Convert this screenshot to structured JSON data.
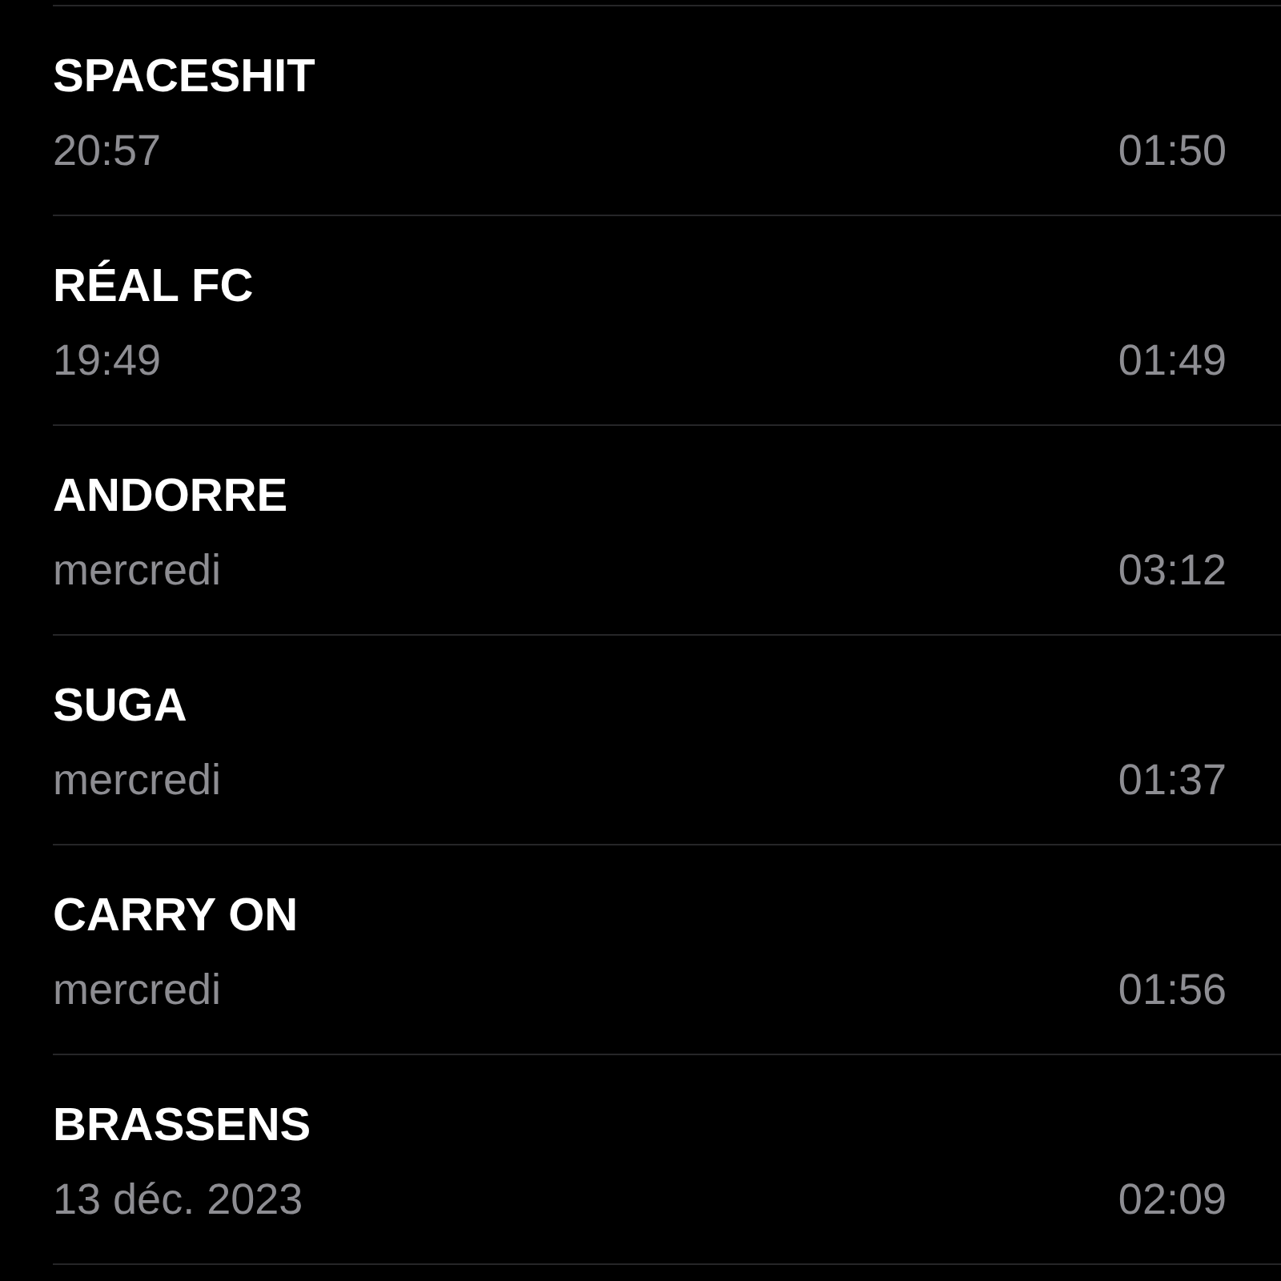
{
  "recordings": [
    {
      "title": "SPACESHIT",
      "date": "20:57",
      "duration": "01:50"
    },
    {
      "title": "RÉAL FC",
      "date": "19:49",
      "duration": "01:49"
    },
    {
      "title": "ANDORRE",
      "date": "mercredi",
      "duration": "03:12"
    },
    {
      "title": "SUGA",
      "date": "mercredi",
      "duration": "01:37"
    },
    {
      "title": "CARRY ON",
      "date": "mercredi",
      "duration": "01:56"
    },
    {
      "title": "BRASSENS",
      "date": "13 déc. 2023",
      "duration": "02:09"
    }
  ]
}
